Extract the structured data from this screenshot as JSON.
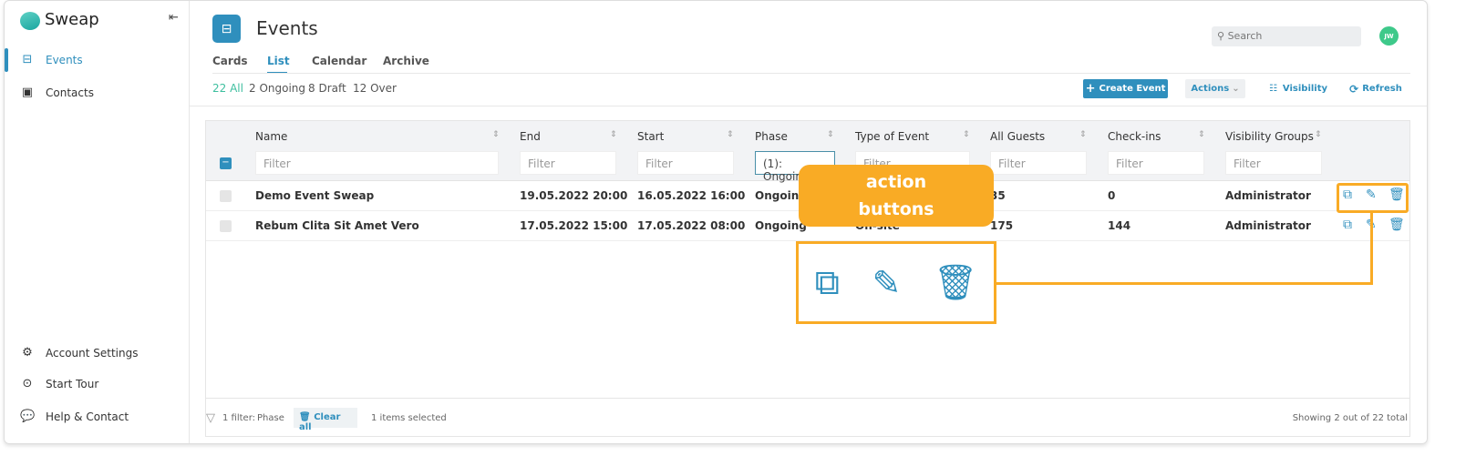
{
  "app": {
    "name": "Sweap",
    "avatar": "JW"
  },
  "sidebar": {
    "items": [
      {
        "label": "Events",
        "icon": "events-icon",
        "active": true
      },
      {
        "label": "Contacts",
        "icon": "contacts-icon"
      }
    ],
    "bottom": [
      {
        "label": "Account Settings",
        "icon": "gear-icon"
      },
      {
        "label": "Start Tour",
        "icon": "play-icon"
      },
      {
        "label": "Help & Contact",
        "icon": "chat-icon"
      }
    ]
  },
  "header": {
    "title": "Events",
    "search_placeholder": "Search"
  },
  "tabs": [
    {
      "label": "Cards"
    },
    {
      "label": "List",
      "active": true
    },
    {
      "label": "Calendar"
    },
    {
      "label": "Archive"
    }
  ],
  "counts": [
    "22 All",
    "2 Ongoing",
    "8 Draft",
    "12 Over"
  ],
  "toolbar": {
    "create": "Create Event",
    "actions": "Actions",
    "visibility": "Visibility",
    "refresh": "Refresh"
  },
  "table": {
    "columns": [
      "Name",
      "End",
      "Start",
      "Phase",
      "Type of Event",
      "All Guests",
      "Check-ins",
      "Visibility Groups"
    ],
    "filters": [
      "Filter",
      "Filter",
      "Filter",
      "(1): Ongoing",
      "Filter",
      "Filter",
      "Filter",
      "Filter"
    ],
    "rows": [
      [
        "Demo Event Sweap",
        "19.05.2022 20:00",
        "16.05.2022 16:00",
        "Ongoing",
        "",
        "35",
        "0",
        "Administrator"
      ],
      [
        "Rebum Clita Sit Amet Vero",
        "17.05.2022 15:00",
        "17.05.2022 08:00",
        "Ongoing",
        "On-site",
        "175",
        "144",
        "Administrator"
      ]
    ]
  },
  "footer": {
    "filter": "1 filter:",
    "filter_field": "Phase",
    "clear": "Clear all",
    "selected": "1 items selected",
    "showing": "Showing 2 out of 22 total"
  },
  "callout": {
    "text_line1": "action",
    "text_line2": "buttons",
    "color": "#f9ab25"
  },
  "colors": {
    "accent": "#2f8fbd",
    "green": "#3ec98a"
  }
}
